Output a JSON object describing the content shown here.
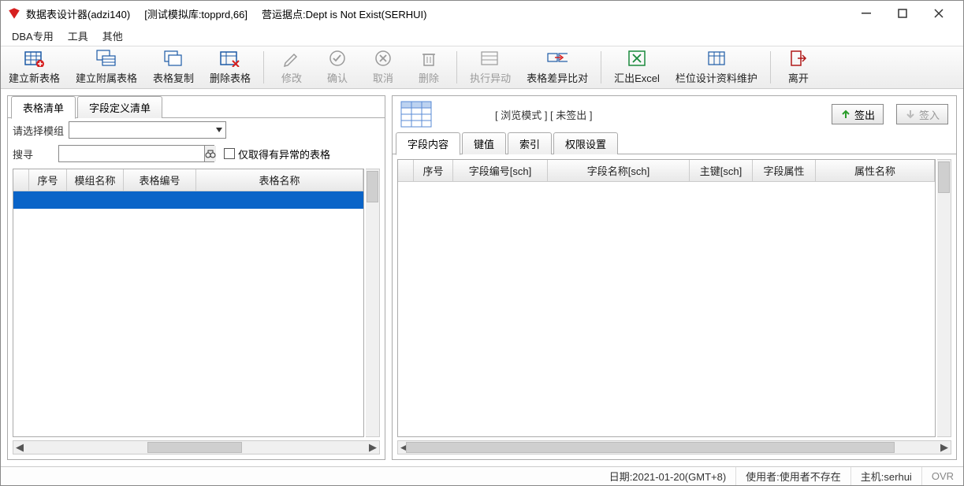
{
  "title": {
    "app": "数据表设计器(adzi140)",
    "db": "[测试模拟库:topprd,66]",
    "site": "营运据点:Dept is Not Exist(SERHUI)"
  },
  "menu": {
    "dba": "DBA专用",
    "tools": "工具",
    "other": "其他"
  },
  "toolbar": {
    "new_table": "建立新表格",
    "new_sub_table": "建立附属表格",
    "copy_table": "表格复制",
    "delete_table": "删除表格",
    "modify": "修改",
    "confirm": "确认",
    "cancel": "取消",
    "remove": "删除",
    "exec_diff": "执行异动",
    "diff_compare": "表格差异比对",
    "export_excel": "汇出Excel",
    "field_design": "栏位设计资料维护",
    "leave": "离开"
  },
  "left": {
    "tabs": {
      "list": "表格清单",
      "field_def": "字段定义清单"
    },
    "select_module_label": "请选择模组",
    "search_label": "搜寻",
    "search_value": "",
    "only_abnormal": "仅取得有异常的表格",
    "cols": {
      "seq": "序号",
      "module": "模组名称",
      "table_code": "表格编号",
      "table_name": "表格名称"
    }
  },
  "right": {
    "mode_label": "[ 浏览模式 ] [ 未签出 ]",
    "checkout": "签出",
    "checkin": "签入",
    "tabs": {
      "field": "字段内容",
      "key": "键值",
      "index": "索引",
      "perm": "权限设置"
    },
    "cols": {
      "seq": "序号",
      "field_code": "字段编号[sch]",
      "field_name": "字段名称[sch]",
      "pk": "主键[sch]",
      "field_attr": "字段属性",
      "attr_name": "属性名称"
    }
  },
  "status": {
    "date": "日期:2021-01-20(GMT+8)",
    "user": "使用者:使用者不存在",
    "host": "主机:serhui",
    "ovr": "OVR"
  }
}
